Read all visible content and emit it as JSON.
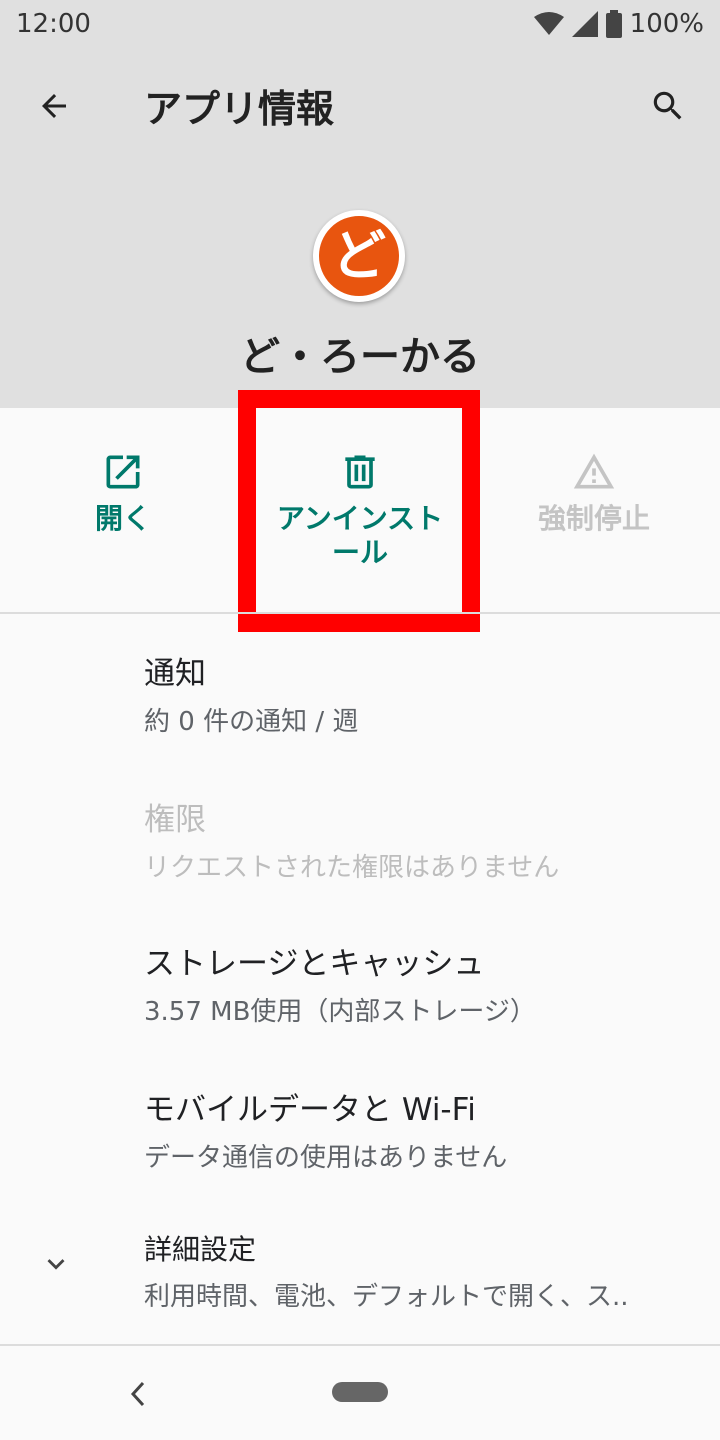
{
  "status_bar": {
    "time": "12:00",
    "battery": "100%"
  },
  "toolbar": {
    "title": "アプリ情報"
  },
  "app": {
    "icon_glyph": "ど",
    "name": "ど・ろーかる"
  },
  "actions": {
    "open_label": "開く",
    "uninstall_label": "アンインストール",
    "force_stop_label": "強制停止"
  },
  "settings": {
    "notifications": {
      "title": "通知",
      "summary": "約 0 件の通知 / 週"
    },
    "permissions": {
      "title": "権限",
      "summary": "リクエストされた権限はありません"
    },
    "storage": {
      "title": "ストレージとキャッシュ",
      "summary": "3.57 MB使用（内部ストレージ）"
    },
    "mobile_data": {
      "title": "モバイルデータと Wi-Fi",
      "summary": "データ通信の使用はありません"
    },
    "advanced": {
      "title": "詳細設定",
      "summary": "利用時間、電池、デフォルトで開く、ス.."
    }
  },
  "colors": {
    "accent": "#00796b",
    "app_icon": "#e8550f",
    "highlight": "#ff0000"
  }
}
